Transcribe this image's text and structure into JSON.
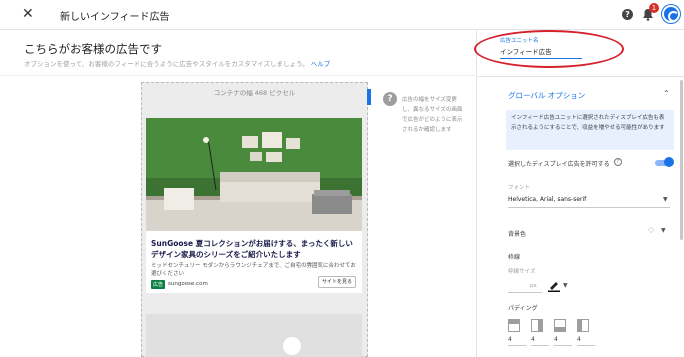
{
  "header": {
    "close_icon": "close-icon",
    "title": "新しいインフィード広告",
    "help_icon": "help-icon",
    "notification_icon": "bell-icon",
    "notification_count": "1",
    "avatar_icon": "account-avatar"
  },
  "main": {
    "heading": "こちらがお客様の広告です",
    "subtext": "オプションを使って、お客様のフィードに合うように広告やスタイルをカスタマイズしましょう。",
    "help_link": "ヘルプ"
  },
  "preview": {
    "container_width": "コンテナの幅 468 ピクセル",
    "ad": {
      "headline": "SunGoose 夏コレクションがお届けする、まったく新しいデザイン家具のシリーズをご紹介いたします",
      "description": "ミッドセンチュリー モダンからラウンジチェアまで、ご自宅の雰囲気に合わせてお選びください",
      "badge": "広告",
      "domain": "sungoose.com",
      "button": "サイトを見る"
    },
    "hint_text": "広告の幅をサイズ変更し、異なるサイズの画面で広告がどのように表示されるか確認します"
  },
  "panel": {
    "name_label": "広告ユニット名",
    "name_value": "インフィード広告",
    "section_title": "グローバル オプション",
    "info": "インフィード広告ユニットに選択されたディスプレイ広告も表示されるようにすることで、収益を増やせる可能性があります",
    "toggle_label": "選択したディスプレイ広告を許可する",
    "toggle_on": true,
    "font_label": "フォント",
    "font_value": "Helvetica, Arial, sans-serif",
    "bg_label": "背景色",
    "border_label": "枠線",
    "border_size_label": "枠線サイズ",
    "px": "px",
    "padding_label": "パディング",
    "padding_values": [
      "4",
      "4",
      "4",
      "4"
    ]
  },
  "colors": {
    "accent": "#1a73e8",
    "highlight_oval": "#d6202c",
    "ad_badge": "#0b8043"
  }
}
